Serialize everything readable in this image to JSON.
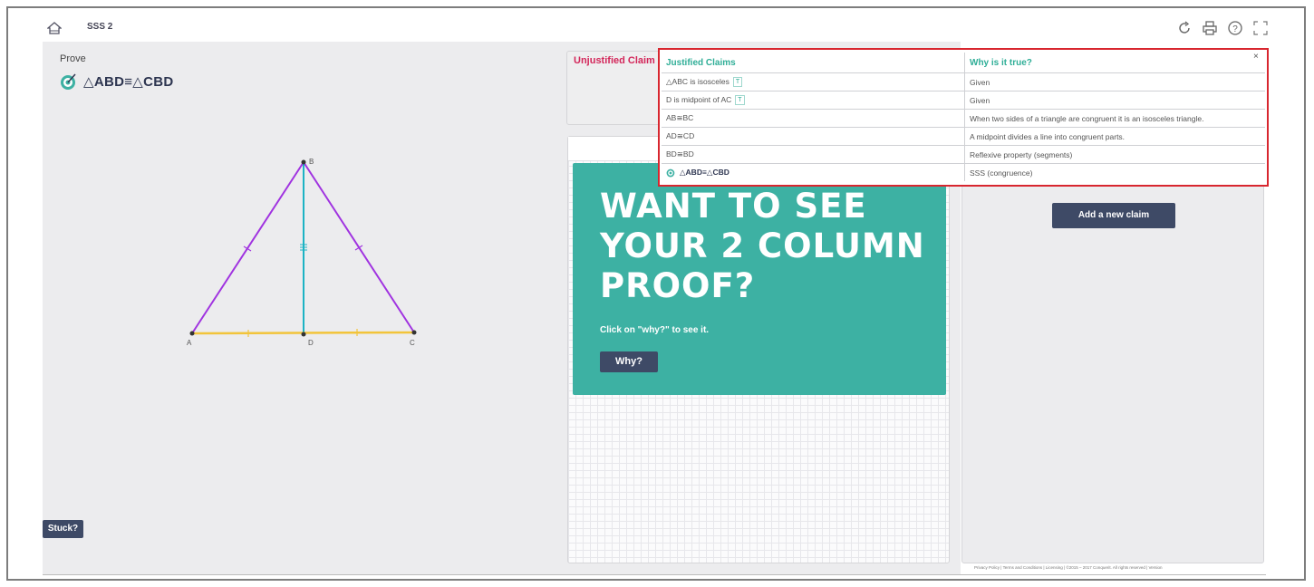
{
  "app": {
    "title": "SSS 2"
  },
  "top_icons": [
    "refresh-icon",
    "print-icon",
    "help-icon",
    "fullscreen-icon"
  ],
  "prove": {
    "label": "Prove",
    "statement": "△ABD≡△CBD"
  },
  "figure": {
    "points": {
      "A": "A",
      "B": "B",
      "C": "C",
      "D": "D"
    },
    "colors": {
      "sides": "#a033e0",
      "altitude": "#1cb3c4",
      "base": "#f2c43a"
    }
  },
  "stuck_button": "Stuck?",
  "unjustified": {
    "title": "Unjustified Claim"
  },
  "promo": {
    "title": "WANT TO SEE YOUR 2 COLUMN PROOF?",
    "subtitle": "Click on \"why?\" to see it.",
    "button": "Why?"
  },
  "add_claim_button": "Add a new claim",
  "footer": "Privacy Policy | Terms and Conditions | Licensing | ©2015 – 2017 Conquerit. All rights reserved | Version",
  "claims": {
    "headers": {
      "claim": "Justified Claims",
      "reason": "Why is it true?"
    },
    "close": "×",
    "rows": [
      {
        "claim": "△ABC is isosceles",
        "badge": "T",
        "reason": "Given"
      },
      {
        "claim": "D is midpoint of AC",
        "badge": "T",
        "reason": "Given"
      },
      {
        "claim": "AB≅BC",
        "badge": "",
        "reason": "When two sides of a triangle are congruent it is an isosceles triangle."
      },
      {
        "claim": "AD≅CD",
        "badge": "",
        "reason": "A midpoint divides a line into congruent parts."
      },
      {
        "claim": "BD≅BD",
        "badge": "",
        "reason": "Reflexive property (segments)"
      },
      {
        "claim": "△ABD≡△CBD",
        "badge": "",
        "reason": "SSS (congruence)"
      }
    ]
  },
  "colors": {
    "accent": "#3db1a3",
    "button": "#3e4a66",
    "alert": "#d8262f",
    "claim_red": "#d3265a"
  }
}
